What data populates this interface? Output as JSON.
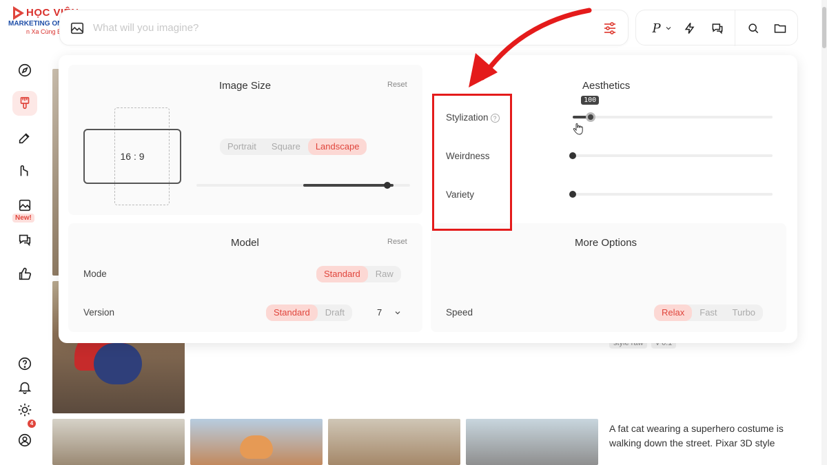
{
  "logo": {
    "line1": "HỌC VIỆN",
    "line2": "MARKETING ONLINE",
    "line3": "n Xa Cùng Bạn",
    "partial_brand": "M"
  },
  "search": {
    "placeholder": "What will you imagine?"
  },
  "toolbar": {
    "personalize_label": "P"
  },
  "sidebar": {
    "new_badge": "New!",
    "notification_count": "4"
  },
  "image_size": {
    "title": "Image Size",
    "reset": "Reset",
    "ratio": "16 : 9",
    "orientation_options": [
      "Portrait",
      "Square",
      "Landscape"
    ],
    "orientation_selected": "Landscape",
    "ratio_slider_position": 1.0
  },
  "aesthetics": {
    "title": "Aesthetics",
    "stylization_label": "Stylization",
    "stylization_help": "?",
    "stylization_value": "100",
    "stylization_fraction": 0.09,
    "weirdness_label": "Weirdness",
    "weirdness_fraction": 0.0,
    "variety_label": "Variety",
    "variety_fraction": 0.0
  },
  "model": {
    "title": "Model",
    "reset": "Reset",
    "mode_label": "Mode",
    "mode_options": [
      "Standard",
      "Raw"
    ],
    "mode_selected": "Standard",
    "version_label": "Version",
    "version_options": [
      "Standard",
      "Draft"
    ],
    "version_selected": "Standard",
    "version_number": "7"
  },
  "more_options": {
    "title": "More Options",
    "speed_label": "Speed",
    "speed_options": [
      "Relax",
      "Fast",
      "Turbo"
    ],
    "speed_selected": "Relax"
  },
  "gallery": {
    "caption": "A fat cat wearing a superhero costume is walking down the street. Pixar 3D style",
    "tags": [
      "style raw",
      "v 6.1"
    ]
  },
  "colors": {
    "accent": "#e0453c",
    "accent_soft": "#fcd8d4",
    "annotation_red": "#e41b1b"
  }
}
